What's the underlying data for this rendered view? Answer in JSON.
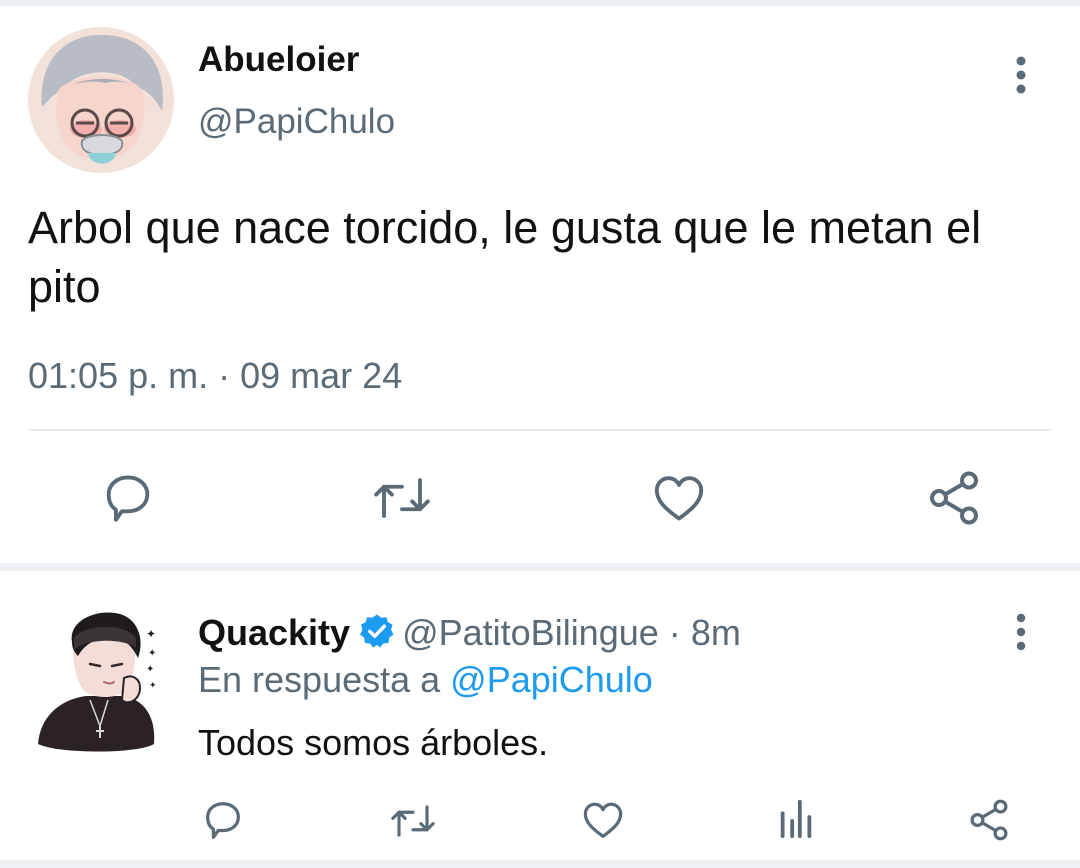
{
  "tweet": {
    "author_name": "Abueloier",
    "author_handle": "@PapiChulo",
    "text": "Arbol que nace torcido, le gusta que le metan el pito",
    "time": "01:05 p. m.",
    "separator": "·",
    "date": "09 mar 24"
  },
  "reply": {
    "author_name": "Quackity",
    "author_handle": "@PatitoBilingue",
    "separator": "·",
    "age": "8m",
    "in_reply_to_prefix": "En respuesta a",
    "in_reply_to_handle": "@PapiChulo",
    "text": "Todos somos árboles."
  },
  "icons": {
    "tweet_actions": [
      "reply-icon",
      "retweet-icon",
      "like-icon",
      "share-icon"
    ],
    "reply_actions": [
      "reply-icon",
      "retweet-icon",
      "like-icon",
      "analytics-icon",
      "share-icon"
    ],
    "menu": "more-vertical-icon",
    "badge": "verified-badge-icon"
  },
  "colors": {
    "icon_gray": "#5b6a77",
    "link_blue": "#1d9bf0",
    "verified_blue": "#1d9bf0",
    "divider": "#e6ecf0"
  }
}
